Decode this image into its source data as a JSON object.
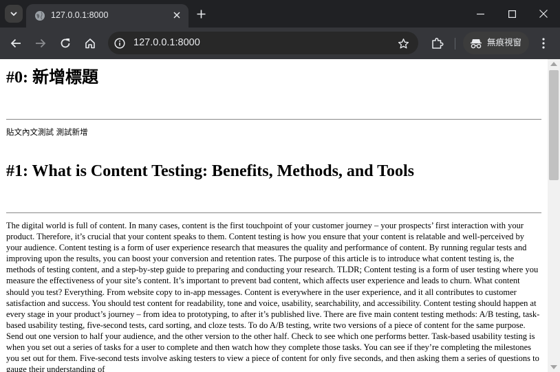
{
  "browser": {
    "tab": {
      "title": "127.0.0.1:8000"
    },
    "address_bar": {
      "url": "127.0.0.1:8000"
    },
    "incognito_label": "無痕視窗"
  },
  "page": {
    "posts": [
      {
        "heading": "#0: 新增標題",
        "body": "貼文內文測試 測試新增"
      },
      {
        "heading": "#1: What is Content Testing: Benefits, Methods, and Tools",
        "body": "The digital world is full of content. In many cases, content is the first touchpoint of your customer journey – your prospects’ first interaction with your product. Therefore, it’s crucial that your content speaks to them. Content testing is how you ensure that your content is relatable and well-perceived by your audience. Content testing is a form of user experience research that measures the quality and performance of content. By running regular tests and improving upon the results, you can boost your conversion and retention rates. The purpose of this article is to introduce what content testing is, the methods of testing content, and a step-by-step guide to preparing and conducting your research. TLDR; Content testing is a form of user testing where you measure the effectiveness of your site’s content. It’s important to prevent bad content, which affects user experience and leads to churn. What content should you test? Everything. From website copy to in-app messages. Content is everywhere in the user experience, and it all contributes to customer satisfaction and success. You should test content for readability, tone and voice, usability, searchability, and accessibility. Content testing should happen at every stage in your product’s journey – from idea to prototyping, to after it’s published live. There are five main content testing methods: A/B testing, task-based usability testing, five-second tests, card sorting, and cloze tests. To do A/B testing, write two versions of a piece of content for the same purpose. Send out one version to half your audience, and the other version to the other half. Check to see which one performs better. Task-based usability testing is when you set out a series of tasks for a user to complete and then watch how they complete those tasks. You can see if they’re completing the milestones you set out for them. Five-second tests involve asking testers to view a piece of content for only five seconds, and then asking them a series of questions to gauge their understanding of"
      }
    ]
  },
  "colors": {
    "chrome_bg": "#202124",
    "toolbar_bg": "#35363a",
    "page_bg": "#ffffff"
  }
}
